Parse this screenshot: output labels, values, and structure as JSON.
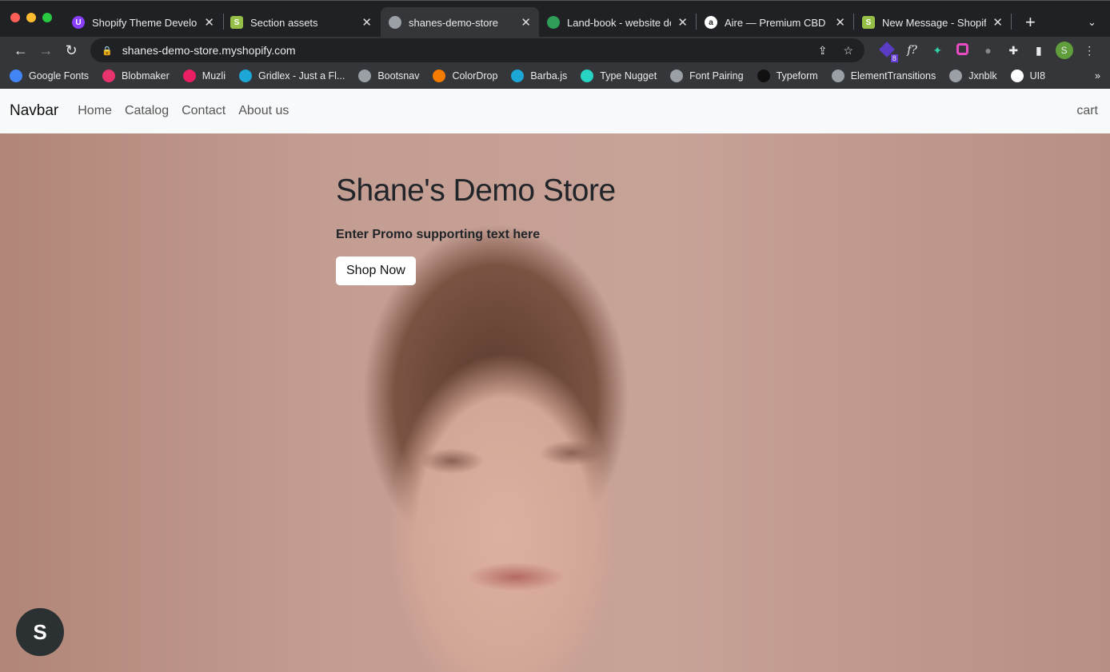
{
  "browser": {
    "tabs": [
      {
        "title": "Shopify Theme Develop",
        "icon": "#8a3ffc",
        "glyph": "U"
      },
      {
        "title": "Section assets",
        "icon": "#95bf47",
        "glyph": "S"
      },
      {
        "title": "shanes-demo-store",
        "icon": "#9aa0a6",
        "glyph": ""
      },
      {
        "title": "Land-book - website de",
        "icon": "#2e9e58",
        "glyph": ""
      },
      {
        "title": "Aire — Premium CBD O",
        "icon": "#ffffff",
        "glyph": "a"
      },
      {
        "title": "New Message - Shopify",
        "icon": "#95bf47",
        "glyph": "S"
      }
    ],
    "url": "shanes-demo-store.myshopify.com",
    "extension_badge": "8",
    "profile_initial": "S",
    "bookmarks": [
      "Google Fonts",
      "Blobmaker",
      "Muzli",
      "Gridlex - Just a Fl...",
      "Bootsnav",
      "ColorDrop",
      "Barba.js",
      "Type Nugget",
      "Font Pairing",
      "Typeform",
      "ElementTransitions",
      "Jxnblk",
      "UI8"
    ],
    "bookmark_colors": [
      "#4285f4",
      "#e8336d",
      "#e91e63",
      "#1ca7d6",
      "#9aa0a6",
      "#f57c00",
      "#1ca7d6",
      "#27d3c3",
      "#9aa0a6",
      "#111111",
      "#9aa0a6",
      "#9aa0a6",
      "#ffffff"
    ]
  },
  "site": {
    "brand": "Navbar",
    "nav": [
      "Home",
      "Catalog",
      "Contact",
      "About us"
    ],
    "cart": "cart",
    "hero": {
      "title": "Shane's Demo Store",
      "subtitle": "Enter Promo supporting text here",
      "cta": "Shop Now"
    }
  }
}
